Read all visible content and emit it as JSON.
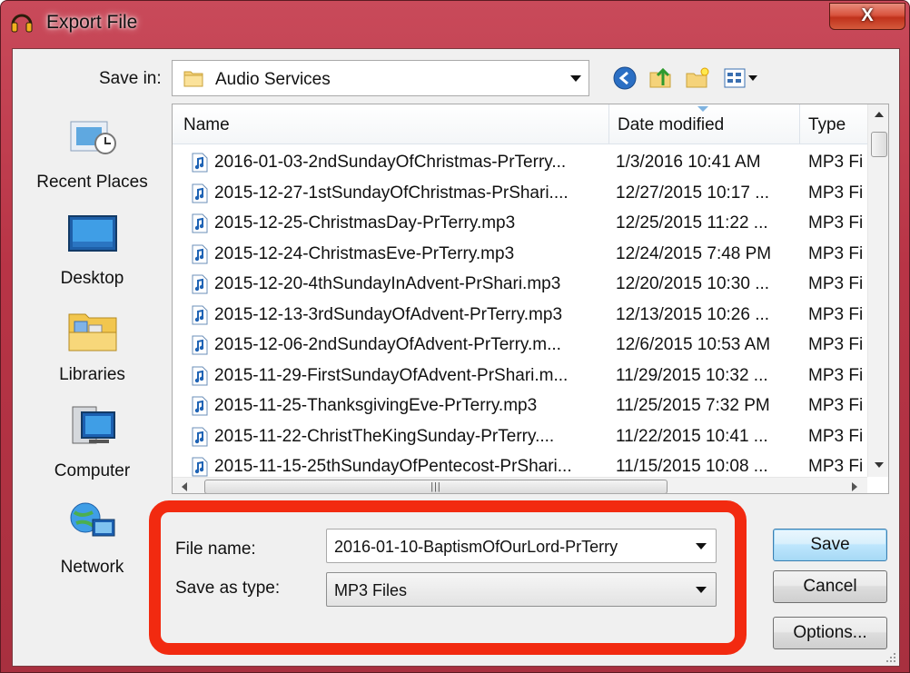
{
  "window": {
    "title": "Export File",
    "close_label": "X"
  },
  "savein": {
    "label": "Save in:",
    "value": "Audio Services"
  },
  "places": [
    {
      "label": "Recent Places",
      "icon": "recent-places-icon"
    },
    {
      "label": "Desktop",
      "icon": "desktop-icon"
    },
    {
      "label": "Libraries",
      "icon": "libraries-icon"
    },
    {
      "label": "Computer",
      "icon": "computer-icon"
    },
    {
      "label": "Network",
      "icon": "network-icon"
    }
  ],
  "columns": {
    "name": "Name",
    "date": "Date modified",
    "type": "Type"
  },
  "files": [
    {
      "name": "2016-01-03-2ndSundayOfChristmas-PrTerry...",
      "date": "1/3/2016 10:41 AM",
      "type": "MP3 Fi"
    },
    {
      "name": "2015-12-27-1stSundayOfChristmas-PrShari....",
      "date": "12/27/2015 10:17 ...",
      "type": "MP3 Fi"
    },
    {
      "name": "2015-12-25-ChristmasDay-PrTerry.mp3",
      "date": "12/25/2015 11:22 ...",
      "type": "MP3 Fi"
    },
    {
      "name": "2015-12-24-ChristmasEve-PrTerry.mp3",
      "date": "12/24/2015 7:48 PM",
      "type": "MP3 Fi"
    },
    {
      "name": "2015-12-20-4thSundayInAdvent-PrShari.mp3",
      "date": "12/20/2015 10:30 ...",
      "type": "MP3 Fi"
    },
    {
      "name": "2015-12-13-3rdSundayOfAdvent-PrTerry.mp3",
      "date": "12/13/2015 10:26 ...",
      "type": "MP3 Fi"
    },
    {
      "name": "2015-12-06-2ndSundayOfAdvent-PrTerry.m...",
      "date": "12/6/2015 10:53 AM",
      "type": "MP3 Fi"
    },
    {
      "name": "2015-11-29-FirstSundayOfAdvent-PrShari.m...",
      "date": "11/29/2015 10:32 ...",
      "type": "MP3 Fi"
    },
    {
      "name": "2015-11-25-ThanksgivingEve-PrTerry.mp3",
      "date": "11/25/2015 7:32 PM",
      "type": "MP3 Fi"
    },
    {
      "name": "2015-11-22-ChristTheKingSunday-PrTerry....",
      "date": "11/22/2015 10:41 ...",
      "type": "MP3 Fi"
    },
    {
      "name": "2015-11-15-25thSundayOfPentecost-PrShari...",
      "date": "11/15/2015 10:08 ...",
      "type": "MP3 Fi"
    }
  ],
  "form": {
    "filename_label": "File name:",
    "filename_value": "2016-01-10-BaptismOfOurLord-PrTerry",
    "type_label": "Save as type:",
    "type_value": "MP3 Files"
  },
  "buttons": {
    "save": "Save",
    "cancel": "Cancel",
    "options": "Options..."
  },
  "colors": {
    "highlight": "#f22a10",
    "titlebar": "#b83446"
  }
}
